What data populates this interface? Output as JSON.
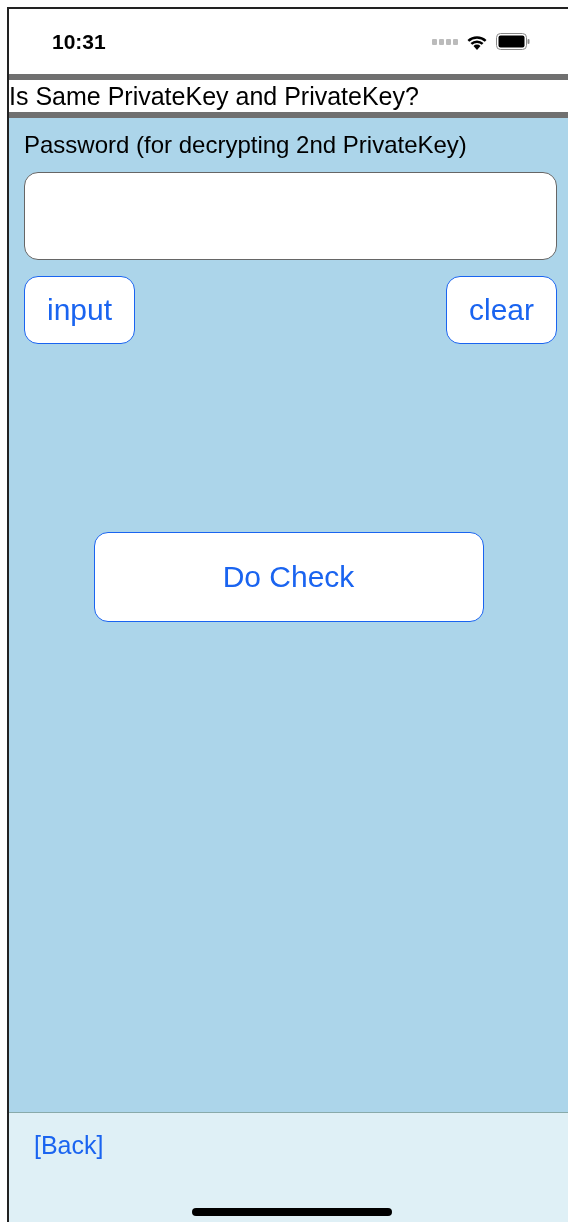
{
  "status_bar": {
    "time": "10:31"
  },
  "title": "Is Same PrivateKey and PrivateKey?",
  "password": {
    "label": "Password (for decrypting 2nd PrivateKey)"
  },
  "buttons": [
    "input",
    "clear"
  ],
  "check_button": "Do Check",
  "back_link": "[Back]"
}
